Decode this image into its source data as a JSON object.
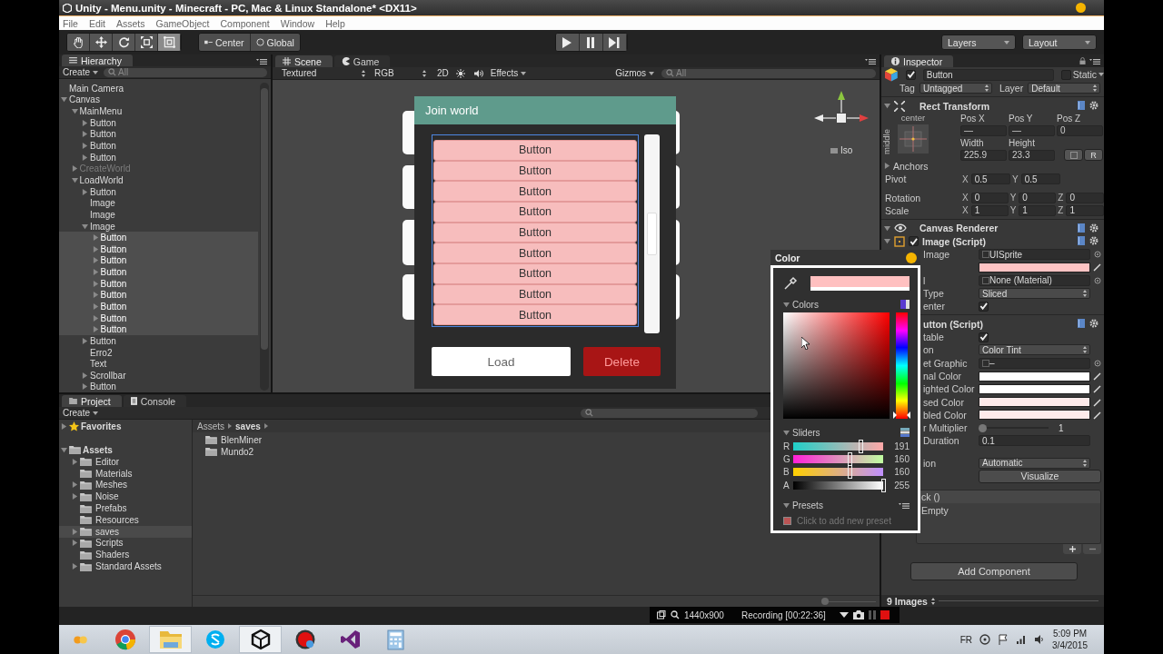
{
  "window": {
    "title": "Unity - Menu.unity - Minecraft - PC, Mac & Linux Standalone* <DX11>"
  },
  "menu": [
    "File",
    "Edit",
    "Assets",
    "GameObject",
    "Component",
    "Window",
    "Help"
  ],
  "toolbar": {
    "tools": [
      {
        "kind": "hand",
        "selected": false
      },
      {
        "kind": "move",
        "selected": false
      },
      {
        "kind": "rotate",
        "selected": false
      },
      {
        "kind": "scale",
        "selected": false
      },
      {
        "kind": "rect",
        "selected": true
      }
    ],
    "pivot": "Center",
    "space": "Global",
    "playback": [
      {
        "kind": "play"
      },
      {
        "kind": "pause"
      },
      {
        "kind": "step"
      }
    ],
    "layers": "Layers",
    "layout": "Layout"
  },
  "hierarchy": {
    "title": "Hierarchy",
    "create": "Create",
    "search_placeholder": "All",
    "items": [
      {
        "label": "Main Camera",
        "selected": false
      },
      {
        "label": "Canvas",
        "selected": false,
        "expanded": true,
        "children": [
          {
            "label": "MainMenu",
            "selected": false,
            "disabled": false,
            "expanded": true,
            "children": [
              {
                "label": "Button",
                "selected": false,
                "expanded": false
              },
              {
                "label": "Button",
                "selected": false,
                "expanded": false
              },
              {
                "label": "Button",
                "selected": false,
                "expanded": false
              },
              {
                "label": "Button",
                "selected": false,
                "expanded": false
              }
            ]
          },
          {
            "label": "CreateWorld",
            "selected": false,
            "disabled": true,
            "expanded": false
          },
          {
            "label": "LoadWorld",
            "selected": false,
            "disabled": false,
            "expanded": true,
            "children": [
              {
                "label": "Button",
                "selected": false,
                "expanded": false
              },
              {
                "label": "Image",
                "selected": false
              },
              {
                "label": "Image",
                "selected": false
              },
              {
                "label": "Image",
                "selected": false,
                "expanded": true,
                "children": [
                  {
                    "label": "Button",
                    "selected": true,
                    "expanded": false
                  },
                  {
                    "label": "Button",
                    "selected": true,
                    "expanded": false
                  },
                  {
                    "label": "Button",
                    "selected": true,
                    "expanded": false
                  },
                  {
                    "label": "Button",
                    "selected": true,
                    "expanded": false
                  },
                  {
                    "label": "Button",
                    "selected": true,
                    "expanded": false
                  },
                  {
                    "label": "Button",
                    "selected": true,
                    "expanded": false
                  },
                  {
                    "label": "Button",
                    "selected": true,
                    "expanded": false
                  },
                  {
                    "label": "Button",
                    "selected": true,
                    "expanded": false
                  },
                  {
                    "label": "Button",
                    "selected": true,
                    "expanded": false
                  }
                ]
              },
              {
                "label": "Button",
                "selected": false,
                "expanded": false
              },
              {
                "label": "Erro2",
                "selected": false
              },
              {
                "label": "Text",
                "selected": false
              },
              {
                "label": "Scrollbar",
                "selected": false,
                "expanded": false
              },
              {
                "label": "Button",
                "selected": false,
                "expanded": false
              }
            ]
          }
        ]
      }
    ]
  },
  "scene": {
    "tabs": [
      {
        "label": "Scene",
        "selected": true
      },
      {
        "label": "Game",
        "selected": false
      }
    ],
    "shading": "Textured",
    "render": "RGB",
    "mode_2d": "2D",
    "effects": "Effects",
    "gizmos": "Gizmos",
    "search_placeholder": "All",
    "projection": "Iso",
    "game_panel": {
      "title": "Join world",
      "list": [
        "Button",
        "Button",
        "Button",
        "Button",
        "Button",
        "Button",
        "Button",
        "Button",
        "Button"
      ],
      "buttons": [
        {
          "label": "Load",
          "kind": "primary"
        },
        {
          "label": "Delete",
          "kind": "danger"
        }
      ]
    }
  },
  "inspector": {
    "title": "Inspector",
    "object": {
      "active": true,
      "name": "Button",
      "static": false,
      "static_label": "Static"
    },
    "tag_label": "Tag",
    "tag": "Untagged",
    "layer_label": "Layer",
    "layer": "Default",
    "rect_transform": {
      "title": "Rect Transform",
      "anchor_h": "center",
      "anchor_v": "middle",
      "fields": [
        {
          "label": "Pos X",
          "value": "—"
        },
        {
          "label": "Pos Y",
          "value": "—"
        },
        {
          "label": "Pos Z",
          "value": "0"
        },
        {
          "label": "Width",
          "value": "225.9"
        },
        {
          "label": "Height",
          "value": "23.3"
        }
      ],
      "raw_button": "R",
      "anchors": "Anchors",
      "vectors": [
        {
          "label": "Pivot",
          "values": [
            {
              "axis": "X",
              "value": "0.5"
            },
            {
              "axis": "Y",
              "value": "0.5"
            }
          ]
        },
        {
          "label": "Rotation",
          "values": [
            {
              "axis": "X",
              "value": "0"
            },
            {
              "axis": "Y",
              "value": "0"
            },
            {
              "axis": "Z",
              "value": "0"
            }
          ]
        },
        {
          "label": "Scale",
          "values": [
            {
              "axis": "X",
              "value": "1"
            },
            {
              "axis": "Y",
              "value": "1"
            },
            {
              "axis": "Z",
              "value": "1"
            }
          ]
        }
      ]
    },
    "canvas_renderer": {
      "title": "Canvas Renderer"
    },
    "image_script": {
      "title": "Image (Script)",
      "enabled": true,
      "rows": [
        {
          "kind": "object",
          "label": "Image",
          "value": "UISprite"
        },
        {
          "kind": "color",
          "color": "#ffc4c4"
        },
        {
          "kind": "object",
          "label": "l",
          "value": "None (Material)"
        },
        {
          "kind": "dropdown",
          "label": "Type",
          "value": "Sliced"
        },
        {
          "kind": "check",
          "label": "enter",
          "checked": true
        }
      ]
    },
    "button_script": {
      "title": "utton (Script)",
      "rows": [
        {
          "kind": "check",
          "label": "table",
          "checked": true
        },
        {
          "kind": "dropdown",
          "label": "on",
          "value": "Color Tint"
        },
        {
          "kind": "object",
          "label": "et Graphic",
          "value": "–"
        },
        {
          "kind": "color",
          "label": "nal Color",
          "color": "#ffffff"
        },
        {
          "kind": "color",
          "label": "ighted Color",
          "color": "#ffffff"
        },
        {
          "kind": "color",
          "label": "sed Color",
          "color": "#fdeaea"
        },
        {
          "kind": "color",
          "label": "bled Color",
          "color": "#fdeaea"
        },
        {
          "kind": "slider",
          "label": "r Multiplier",
          "level": 0,
          "value": "1"
        },
        {
          "kind": "text",
          "label": "Duration",
          "value": "0.1"
        },
        {
          "kind": "gap"
        },
        {
          "kind": "dropdown",
          "label": "ion",
          "value": "Automatic"
        },
        {
          "kind": "button",
          "value": "Visualize"
        }
      ]
    },
    "on_click": {
      "title": "ck ()",
      "entry": "Empty"
    },
    "add_component": "Add Component",
    "footer": "9 Images"
  },
  "project": {
    "tabs": [
      {
        "label": "Project",
        "selected": true
      },
      {
        "label": "Console",
        "selected": false
      }
    ],
    "create": "Create",
    "favorites": {
      "label": "Favorites",
      "expanded": false
    },
    "assets": {
      "label": "Assets",
      "expanded": true,
      "children": [
        {
          "label": "Editor",
          "expanded": false,
          "selected": false
        },
        {
          "label": "Materials",
          "selected": false
        },
        {
          "label": "Meshes",
          "expanded": false,
          "selected": false
        },
        {
          "label": "Noise",
          "expanded": false,
          "selected": false
        },
        {
          "label": "Prefabs",
          "selected": false
        },
        {
          "label": "Resources",
          "selected": false
        },
        {
          "label": "saves",
          "expanded": false,
          "selected": true
        },
        {
          "label": "Scripts",
          "expanded": false,
          "selected": false
        },
        {
          "label": "Shaders",
          "selected": false
        },
        {
          "label": "Standard Assets",
          "expanded": false,
          "selected": false
        }
      ]
    },
    "breadcrumb": [
      "Assets",
      "saves"
    ],
    "folders": [
      "BlenMiner",
      "Mundo2"
    ],
    "zoom": {
      "level": 0
    }
  },
  "color_picker": {
    "title": "Color",
    "color": "#ffc0c0",
    "hue": {
      "level": 1
    },
    "colors_label": "Colors",
    "sliders_label": "Sliders",
    "sliders": [
      {
        "channel": "R",
        "level": 0.749,
        "value": "191"
      },
      {
        "channel": "G",
        "level": 0.627,
        "value": "160"
      },
      {
        "channel": "B",
        "level": 0.627,
        "value": "160"
      },
      {
        "channel": "A",
        "level": 1,
        "value": "255"
      }
    ],
    "presets_label": "Presets",
    "presets_hint": "Click to add new preset"
  },
  "recorder": {
    "resolution": "1440x900",
    "status": "Recording [00:22:36]"
  },
  "taskbar": {
    "apps": [
      {
        "kind": "dots",
        "selected": false
      },
      {
        "kind": "browser",
        "selected": false
      },
      {
        "kind": "folder",
        "selected": true
      },
      {
        "kind": "chat",
        "selected": false
      },
      {
        "kind": "unity",
        "selected": true
      },
      {
        "kind": "record",
        "selected": false
      },
      {
        "kind": "studio",
        "selected": false
      },
      {
        "kind": "calculator",
        "selected": false
      }
    ],
    "language": "FR",
    "time": "5:09 PM",
    "date": "3/4/2015"
  }
}
